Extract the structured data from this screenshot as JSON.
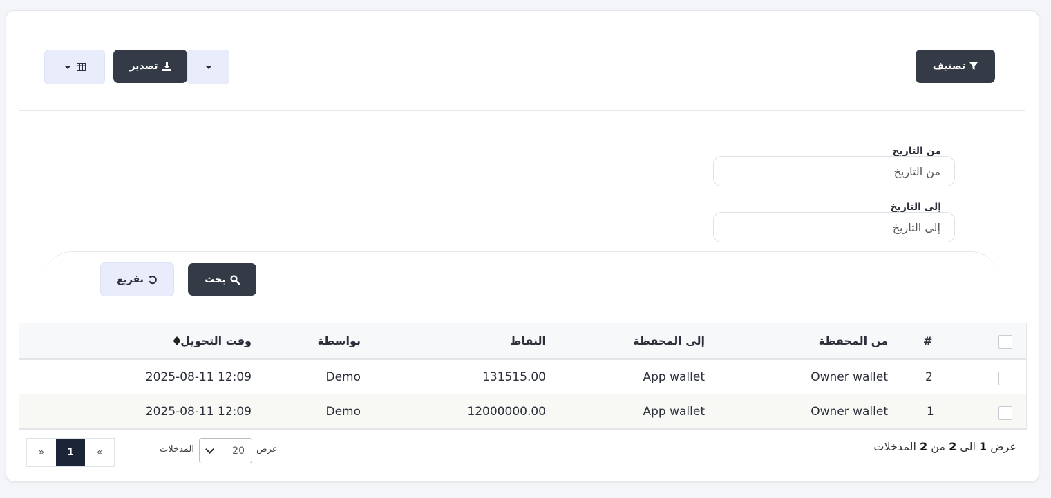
{
  "toolbar": {
    "filter_label": "تصنيف",
    "export_label": "تصدير"
  },
  "filters": {
    "from_date_label": "من التاريخ",
    "from_date_placeholder": "من التاريخ",
    "to_date_label": "إلى التاريخ",
    "to_date_placeholder": "إلى التاريخ",
    "search_label": "بحث",
    "reset_label": "تفريغ"
  },
  "table": {
    "columns": {
      "index": "#",
      "from_wallet": "من المحفظة",
      "to_wallet": "إلى المحفظة",
      "points": "النقاط",
      "by": "بواسطة",
      "transfer_time": "وقت التحويل"
    },
    "rows": [
      {
        "index": "2",
        "from_wallet": "Owner wallet",
        "to_wallet": "App wallet",
        "points": "131515.00",
        "by": "Demo",
        "transfer_time": "2025-08-11 12:09"
      },
      {
        "index": "1",
        "from_wallet": "Owner wallet",
        "to_wallet": "App wallet",
        "points": "12000000.00",
        "by": "Demo",
        "transfer_time": "2025-08-11 12:09"
      }
    ]
  },
  "footer": {
    "info_show": "عرض",
    "info_start": "1",
    "info_to": "الى",
    "info_end": "2",
    "info_of": "من",
    "info_total": "2",
    "info_entries": "المدخلات",
    "length_show": "عرض",
    "length_value": "20",
    "length_entries": "المدخلات",
    "pager_prev": "«",
    "pager_current": "1",
    "pager_next": "»"
  },
  "colors": {
    "primary_dark": "#343a46",
    "light_button": "#e8ecfb",
    "active_page": "#1c2537"
  },
  "icons": [
    "filter-icon",
    "download-icon",
    "table-icon",
    "search-icon",
    "undo-icon",
    "sort-icon"
  ]
}
